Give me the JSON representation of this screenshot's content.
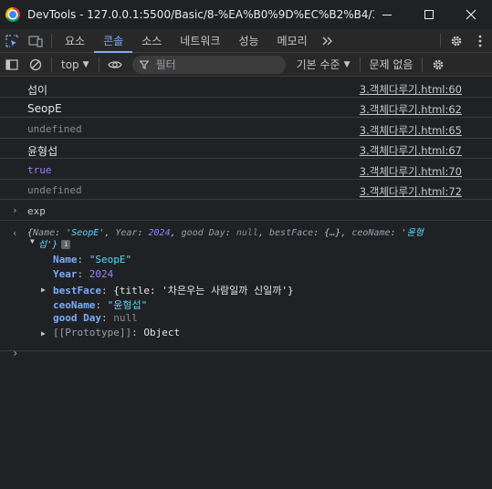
{
  "window": {
    "title": "DevTools - 127.0.0.1:5500/Basic/8-%EA%B0%9D%EC%B2%B4/3.%E..."
  },
  "tabs": [
    {
      "label": "요소"
    },
    {
      "label": "콘솔"
    },
    {
      "label": "소스"
    },
    {
      "label": "네트워크"
    },
    {
      "label": "성능"
    },
    {
      "label": "메모리"
    }
  ],
  "toolbar": {
    "context": "top",
    "filter_placeholder": "필터",
    "levels": "기본 수준",
    "issues": "문제 없음"
  },
  "logs": [
    {
      "text": "섭이",
      "source": "3.객체다루기.html:60",
      "kind": "string"
    },
    {
      "text": "SeopE",
      "source": "3.객체다루기.html:62",
      "kind": "string"
    },
    {
      "text": "undefined",
      "source": "3.객체다루기.html:65",
      "kind": "undefined"
    },
    {
      "text": "윤형섭",
      "source": "3.객체다루기.html:67",
      "kind": "string"
    },
    {
      "text": "true",
      "source": "3.객체다루기.html:70",
      "kind": "boolean"
    },
    {
      "text": "undefined",
      "source": "3.객체다루기.html:72",
      "kind": "undefined"
    }
  ],
  "input": {
    "text": "exp"
  },
  "result": {
    "preview_line1": {
      "open": "{",
      "k1": "Name",
      "v1": "'SeopE'",
      "k2": "Year",
      "v2": "2024",
      "k3": "good Day",
      "v3": "null",
      "k4": "bestFace",
      "v4": "{…}",
      "k5": "ceoName",
      "v5": "'윤형"
    },
    "preview_line2": "섭'}",
    "properties": [
      {
        "key": "Name",
        "value": "\"SeopE\"",
        "type": "string"
      },
      {
        "key": "Year",
        "value": "2024",
        "type": "number"
      },
      {
        "key": "bestFace",
        "value": "{title: '차은우는 사람일까 신일까'}",
        "type": "object"
      },
      {
        "key": "ceoName",
        "value": "\"윤형섭\"",
        "type": "string"
      },
      {
        "key": "good Day",
        "value": "null",
        "type": "null"
      },
      {
        "key": "[[Prototype]]",
        "value": "Object",
        "type": "proto"
      }
    ]
  }
}
